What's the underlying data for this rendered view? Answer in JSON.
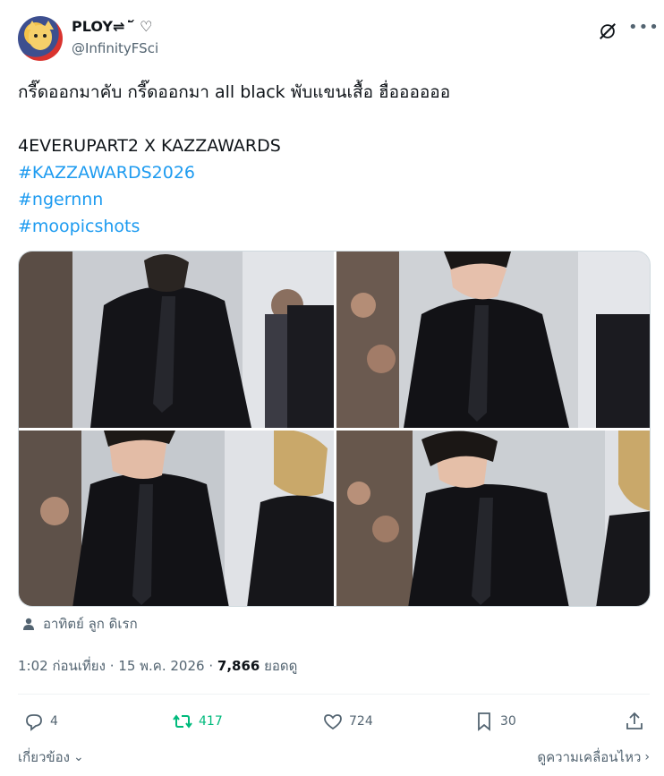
{
  "author": {
    "display_name": "PLOY⇌ ͘ ᷄ ♡",
    "handle": "@InfinityFSci"
  },
  "tweet": {
    "line1": "กรี๊ดออกมาคับ กรี๊ดออกมา all black พับแขนเสื้อ ฮื่ออออออ",
    "line2": "4EVERUPART2 X KAZZAWARDS",
    "hashtags": [
      "#KAZZAWARDS2026",
      "#ngernnn",
      "#moopicshots"
    ]
  },
  "media": {
    "count": 4
  },
  "location": "อาทิตย์ ลูก ดิเรก",
  "meta": {
    "time": "1:02 ก่อนเที่ยง",
    "separator": "·",
    "date": "15 พ.ค. 2026",
    "views_count": "7,866",
    "views_label": "ยอดดู"
  },
  "actions": {
    "reply_count": "4",
    "retweet_count": "417",
    "like_count": "724",
    "bookmark_count": "30"
  },
  "footer": {
    "related_label": "เกี่ยวข้อง",
    "see_more_label": "ดูความเคลื่อนไหว"
  },
  "colors": {
    "link": "#1d9bf0",
    "retweet_active": "#00ba7c",
    "secondary_text": "#536471",
    "primary_text": "#0f1419"
  }
}
